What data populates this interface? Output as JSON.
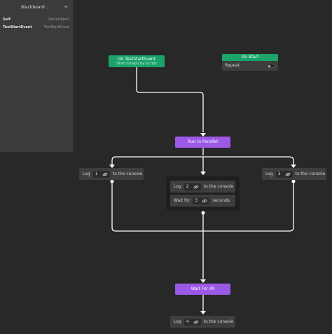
{
  "blackboard": {
    "title": "Blackboard",
    "variables": [
      {
        "name": "Self",
        "type": "GameObject"
      },
      {
        "name": "TestStartEvent",
        "type": "TestStartEvent"
      }
    ]
  },
  "nodes": {
    "on_test_start_event": {
      "title": "On TestStartEvent",
      "subtitle": "Start Graph by script"
    },
    "on_start": {
      "title": "On Start",
      "repeat_label": "Repeat",
      "repeat_on": false
    },
    "run_in_parallel": {
      "title": "Run In Parallel"
    },
    "log1": {
      "prefix": "Log",
      "value": "1",
      "suffix": "to the console"
    },
    "log2": {
      "prefix": "Log",
      "value": "2",
      "suffix": "to the console"
    },
    "wait": {
      "prefix": "Wait for",
      "value": "3",
      "suffix": "seconds"
    },
    "log3": {
      "prefix": "Log",
      "value": "3",
      "suffix": "to the console"
    },
    "wait_for_all": {
      "title": "Wait For All"
    },
    "log4": {
      "prefix": "Log",
      "value": "4",
      "suffix": "to the console"
    }
  },
  "colors": {
    "background": "#282828",
    "event": "#1aa46a",
    "flow": "#9b59e6",
    "node": "#3e3e3e",
    "edge": "#ffffff"
  }
}
